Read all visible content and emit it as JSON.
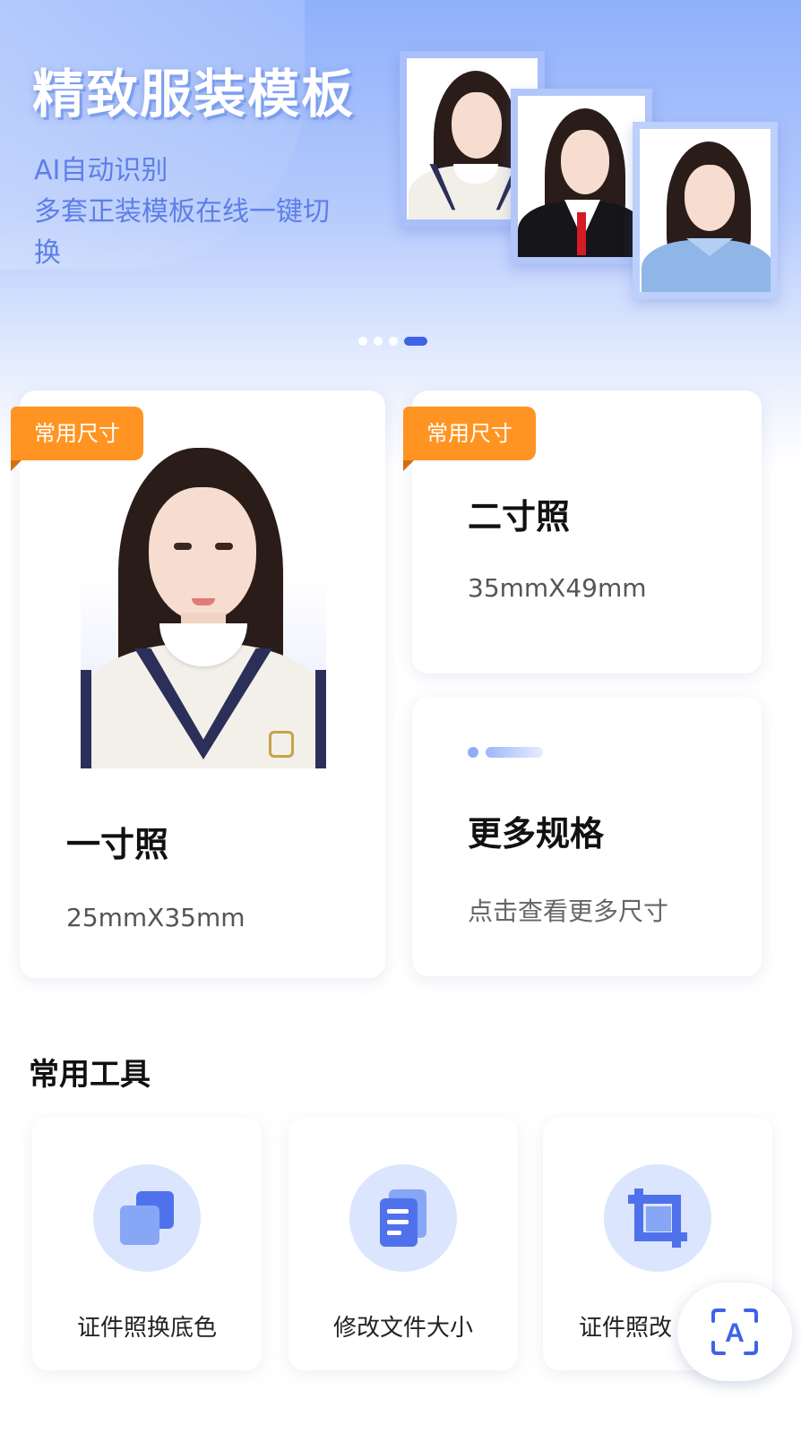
{
  "banner": {
    "title": "精致服装模板",
    "subtitle_line1": "AI自动识别",
    "subtitle_line2": "多套正装模板在线一键切",
    "subtitle_line3": "换",
    "carousel_dots": 4,
    "active_dot": 4,
    "outfits": [
      "school-uniform",
      "suit-red-tie",
      "blue-shirt"
    ]
  },
  "cards": {
    "one_inch": {
      "badge": "常用尺寸",
      "title": "一寸照",
      "size": "25mmX35mm"
    },
    "two_inch": {
      "badge": "常用尺寸",
      "title": "二寸照",
      "size": "35mmX49mm"
    },
    "more": {
      "title": "更多规格",
      "subtitle": "点击查看更多尺寸"
    }
  },
  "tools": {
    "section_title": "常用工具",
    "items": [
      {
        "label": "证件照换底色",
        "icon": "layers-icon"
      },
      {
        "label": "修改文件大小",
        "icon": "document-icon"
      },
      {
        "label": "证件照改",
        "icon": "crop-icon"
      }
    ]
  },
  "fab": {
    "icon": "scan-text-icon",
    "glyph": "A"
  },
  "colors": {
    "accent": "#3f63e6",
    "badge": "#ff9422",
    "icon_bg": "#dbe5fd",
    "icon_fg": "#4f72ec"
  }
}
